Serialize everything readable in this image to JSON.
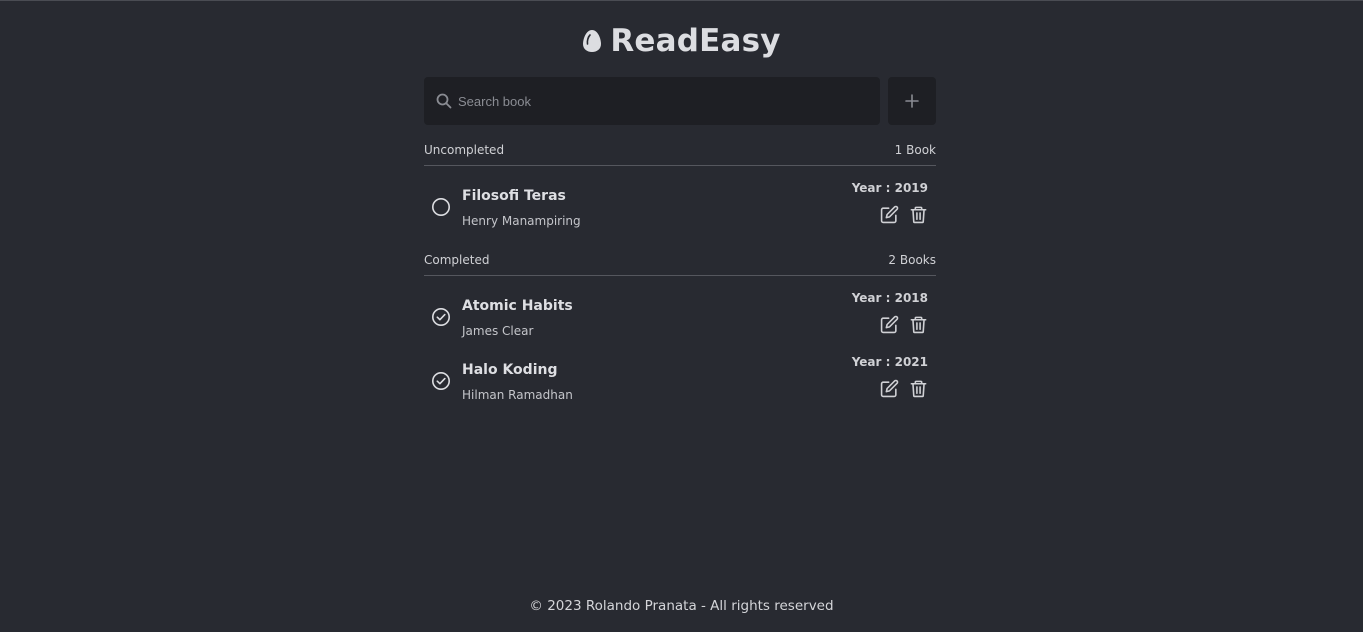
{
  "app": {
    "title": "ReadEasy",
    "logo_icon": "egg-icon"
  },
  "search": {
    "placeholder": "Search book",
    "value": ""
  },
  "add_button": {
    "icon": "plus-icon"
  },
  "sections": [
    {
      "name": "Uncompleted",
      "count": "1 Book",
      "books": [
        {
          "title": "Filosofi Teras",
          "author": "Henry Manampiring",
          "year": "Year : 2019",
          "completed": false
        }
      ]
    },
    {
      "name": "Completed",
      "count": "2 Books",
      "books": [
        {
          "title": "Atomic Habits",
          "author": "James Clear",
          "year": "Year : 2018",
          "completed": true
        },
        {
          "title": "Halo Koding",
          "author": "Hilman Ramadhan",
          "year": "Year : 2021",
          "completed": true
        }
      ]
    }
  ],
  "footer": {
    "text": "© 2023 Rolando Pranata - All rights reserved"
  },
  "colors": {
    "background": "#282a31",
    "surface": "#1e1f24",
    "text": "#d8d9dd"
  }
}
